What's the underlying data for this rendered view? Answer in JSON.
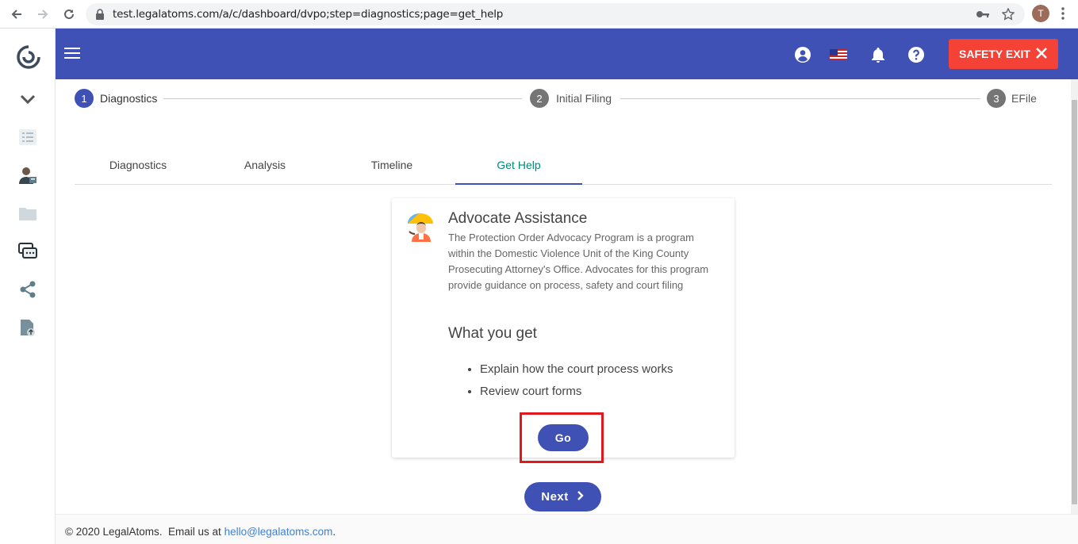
{
  "browser": {
    "url": "test.legalatoms.com/a/c/dashboard/dvpo;step=diagnostics;page=get_help",
    "profile_initial": "T"
  },
  "appbar": {
    "safety_exit_label": "SAFETY EXIT",
    "colors": {
      "primary": "#3f51b5",
      "danger": "#f44336"
    }
  },
  "stepper": {
    "steps": [
      {
        "number": "1",
        "label": "Diagnostics",
        "active": true
      },
      {
        "number": "2",
        "label": "Initial Filing",
        "active": false
      },
      {
        "number": "3",
        "label": "EFile",
        "active": false
      }
    ]
  },
  "tabs": [
    {
      "label": "Diagnostics",
      "active": false
    },
    {
      "label": "Analysis",
      "active": false
    },
    {
      "label": "Timeline",
      "active": false
    },
    {
      "label": "Get Help",
      "active": true
    }
  ],
  "card": {
    "title": "Advocate Assistance",
    "description": "The Protection Order Advocacy Program is a program within the Domestic Violence Unit of the King County Prosecuting Attorney's Office. Advocates for this program provide guidance on process, safety and court filing",
    "subtitle": "What you get",
    "benefits": [
      "Explain how the court process works",
      "Review court forms"
    ],
    "go_label": "Go"
  },
  "next_label": "Next",
  "footer": {
    "text": "© 2020 LegalAtoms.  Email us at ",
    "email": "hello@legalatoms.com",
    "suffix": "."
  }
}
